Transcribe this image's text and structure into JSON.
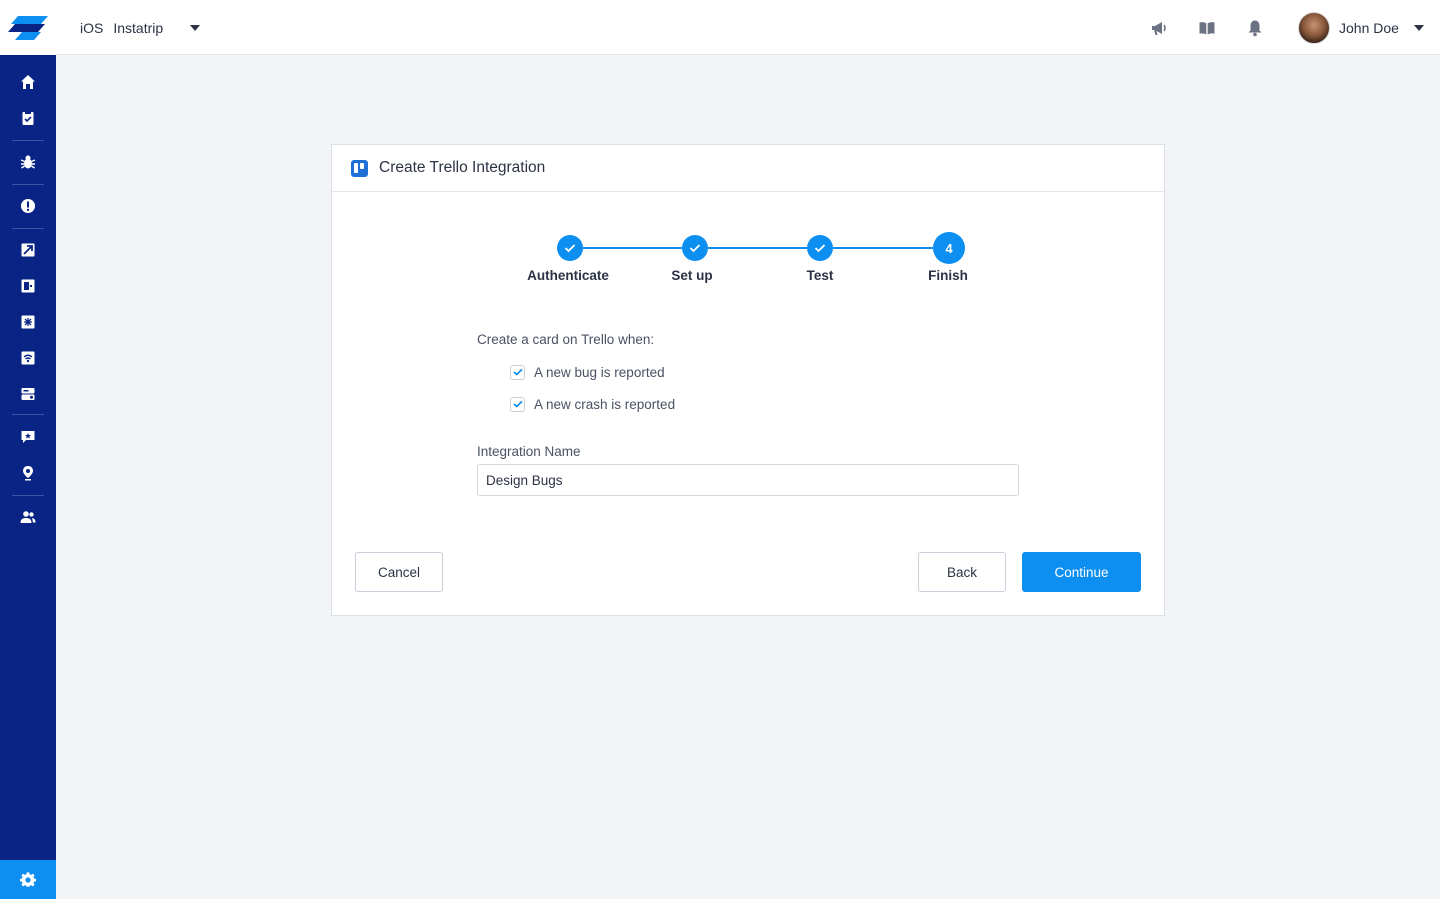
{
  "topbar": {
    "platform": "iOS",
    "app_name": "Instatrip",
    "user_name": "John Doe"
  },
  "sidebar": {
    "items": [
      {
        "icon": "home-icon"
      },
      {
        "icon": "clipboard-icon"
      },
      {
        "icon": "bug-icon"
      },
      {
        "icon": "alert-icon"
      },
      {
        "icon": "rocket-icon"
      },
      {
        "icon": "phone-icon"
      },
      {
        "icon": "snowflake-icon"
      },
      {
        "icon": "wifi-icon"
      },
      {
        "icon": "server-icon"
      },
      {
        "icon": "feedback-icon"
      },
      {
        "icon": "map-pin-icon"
      },
      {
        "icon": "users-icon"
      }
    ],
    "settings_icon": "gear-icon"
  },
  "dialog": {
    "title": "Create Trello Integration",
    "steps": [
      {
        "label": "Authenticate",
        "state": "done"
      },
      {
        "label": "Set up",
        "state": "done"
      },
      {
        "label": "Test",
        "state": "done"
      },
      {
        "label": "Finish",
        "state": "current",
        "number": "4"
      }
    ],
    "section_label": "Create a card on Trello when:",
    "options": [
      {
        "label": "A new bug is reported",
        "checked": true
      },
      {
        "label": "A new crash is reported",
        "checked": true
      }
    ],
    "integration_name_label": "Integration Name",
    "integration_name_value": "Design Bugs",
    "buttons": {
      "cancel": "Cancel",
      "back": "Back",
      "continue": "Continue"
    }
  },
  "colors": {
    "sidebar": "#0a2486",
    "accent": "#0d8ef1",
    "background": "#f2f4f8"
  }
}
